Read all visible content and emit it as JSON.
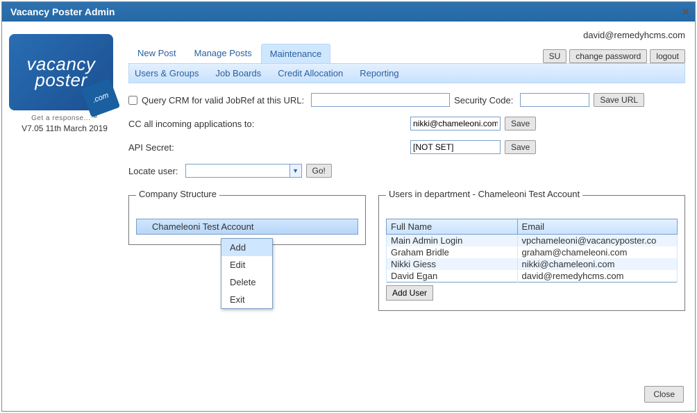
{
  "window": {
    "title": "Vacancy Poster Admin"
  },
  "sidebar": {
    "logo_line1": "vacancy",
    "logo_line2": "poster",
    "logo_badge": ".com",
    "tagline": "Get a response...™",
    "version": "V7.05 11th March 2019"
  },
  "header": {
    "user_email": "david@remedyhcms.com",
    "tabs": [
      {
        "label": "New Post",
        "active": false
      },
      {
        "label": "Manage Posts",
        "active": false
      },
      {
        "label": "Maintenance",
        "active": true
      }
    ],
    "buttons": {
      "su": "SU",
      "change_password": "change password",
      "logout": "logout"
    },
    "subtabs": {
      "users_groups": "Users & Groups",
      "job_boards": "Job Boards",
      "credit_allocation": "Credit Allocation",
      "reporting": "Reporting"
    }
  },
  "form": {
    "query_crm_label": "Query CRM for valid JobRef at this URL:",
    "query_crm_url": "",
    "security_code_label": "Security Code:",
    "security_code": "",
    "save_url_btn": "Save URL",
    "cc_label": "CC all incoming applications to:",
    "cc_value": "nikki@chameleoni.com",
    "api_secret_label": "API Secret:",
    "api_secret_value": "[NOT SET]",
    "save_btn": "Save",
    "locate_label": "Locate user:",
    "locate_value": "",
    "go_btn": "Go!"
  },
  "company_structure": {
    "legend": "Company Structure",
    "root": "Chameleoni Test Account",
    "menu": {
      "add": "Add",
      "edit": "Edit",
      "delete": "Delete",
      "exit": "Exit"
    }
  },
  "users_panel": {
    "legend": "Users in department - Chameleoni Test Account",
    "col_name": "Full Name",
    "col_email": "Email",
    "rows": [
      {
        "name": "Main Admin Login",
        "email": "vpchameleoni@vacancyposter.co"
      },
      {
        "name": "Graham Bridle",
        "email": "graham@chameleoni.com"
      },
      {
        "name": "Nikki Giess",
        "email": "nikki@chameleoni.com"
      },
      {
        "name": "David Egan",
        "email": "david@remedyhcms.com"
      }
    ],
    "add_user_btn": "Add User"
  },
  "footer": {
    "close_btn": "Close"
  }
}
